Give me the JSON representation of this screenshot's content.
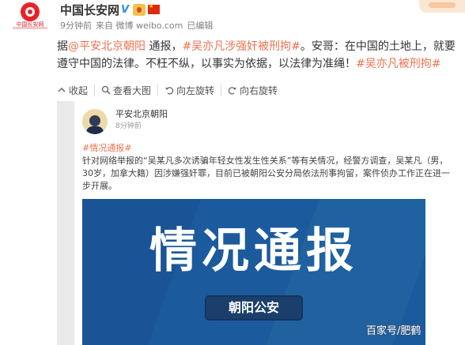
{
  "header": {
    "logo_text": "中国长安网",
    "author": "中国长安网",
    "verified_mark": "V",
    "meta": {
      "time": "9分钟前",
      "source": "来自 微博 weibo.com",
      "edited": "已编辑"
    }
  },
  "post": {
    "prefix": "据",
    "mention": "@平安北京朝阳",
    "text1": " 通报，",
    "hashtag1": "#吴亦凡涉强奸被刑拘#",
    "text2": "。安哥：在中国的土地上，就要遵守中国的法律。不枉不纵，以事实为依据，以法律为准绳！",
    "hashtag2": "#吴亦凡被刑拘#"
  },
  "actions": [
    {
      "label": "收起",
      "icon": "collapse-icon"
    },
    {
      "label": "查看大图",
      "icon": "zoom-icon"
    },
    {
      "label": "向左旋转",
      "icon": "rotate-left-icon"
    },
    {
      "label": "向右旋转",
      "icon": "rotate-right-icon"
    }
  ],
  "card": {
    "author": "平安北京朝阳",
    "time": "8分钟前",
    "tag": "#情况通报#",
    "body": "针对网络举报的“吴某凡多次诱骗年轻女性发生性关系”等有关情况，经警方调查，吴某凡（男，30岁，加拿大籍）因涉嫌强奸罪，目前已被朝阳公安分局依法刑事拘留，案件侦办工作正在进一步开展。",
    "banner_title": "情况通报",
    "banner_badge": "朝阳公安"
  },
  "watermark": "百家号/肥鹤",
  "colors": {
    "link": "#eb7350",
    "banner": "#1c5a9e",
    "verified": "#2b8ee8"
  }
}
